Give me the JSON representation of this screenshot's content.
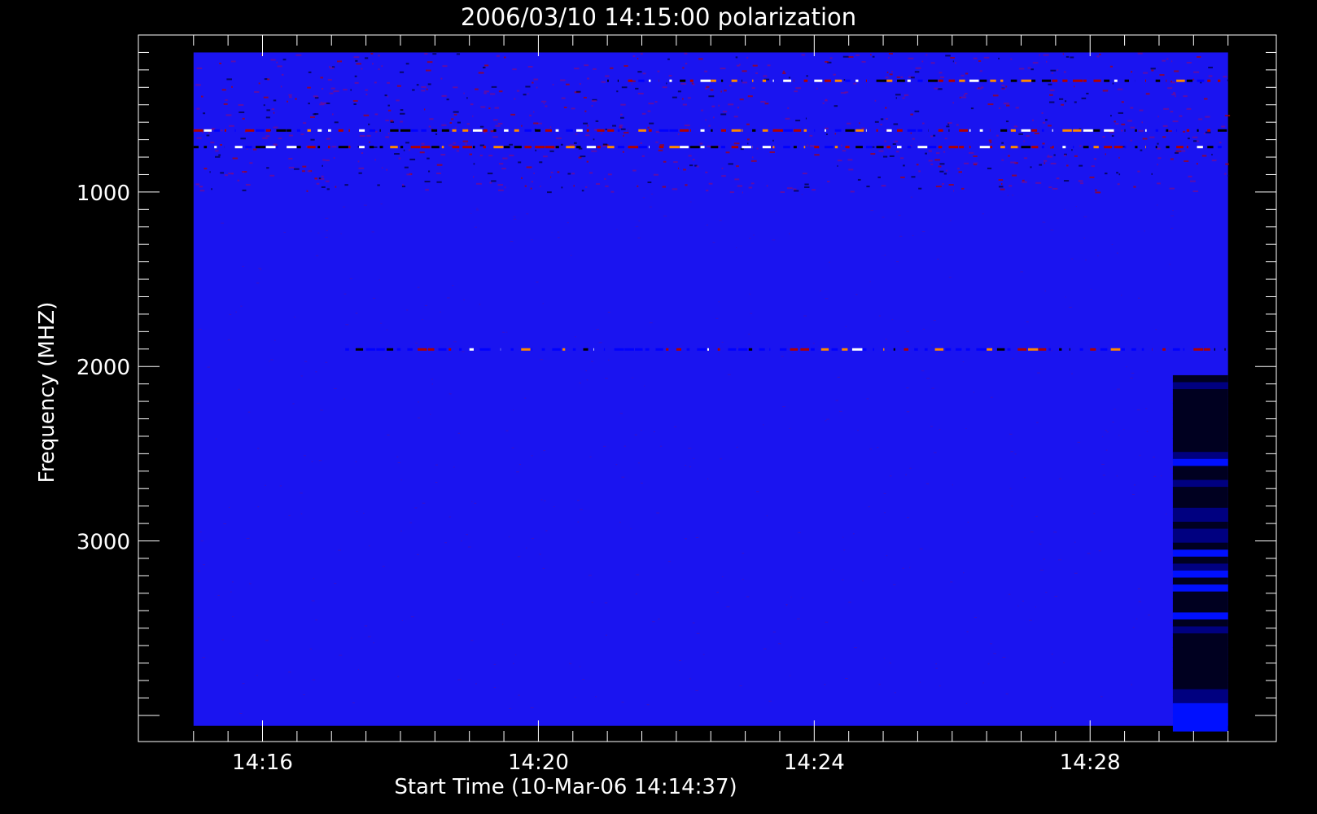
{
  "chart_data": {
    "type": "heatmap",
    "title": "2006/03/10 14:15:00 polarization",
    "xlabel": "Start Time (10-Mar-06 14:14:37)",
    "ylabel": "Frequency (MHZ)",
    "x_ticks": [
      {
        "label": "14:16",
        "minutes": 1.0
      },
      {
        "label": "14:20",
        "minutes": 5.0
      },
      {
        "label": "14:24",
        "minutes": 9.0
      },
      {
        "label": "14:28",
        "minutes": 13.0
      }
    ],
    "x_range_minutes": [
      -0.8,
      15.7
    ],
    "x_data_range_minutes": [
      0.0,
      15.0
    ],
    "y_ticks": [
      {
        "label": "1000",
        "value": 1000
      },
      {
        "label": "2000",
        "value": 2000
      },
      {
        "label": "3000",
        "value": 3000
      }
    ],
    "y_range": [
      100,
      4150
    ],
    "y_data_range": [
      200,
      4060
    ],
    "y_reversed": true,
    "y_minor_step": 100,
    "x_minor_step_minutes": 0.5,
    "colormap": [
      "#000000",
      "#0000ff",
      "#b00000",
      "#ff8800",
      "#ffffff"
    ],
    "background_color": "#1a14f0",
    "features": [
      {
        "type": "band",
        "freq": 360,
        "t0": 6.0,
        "t1": 15.0,
        "intensity": 0.9
      },
      {
        "type": "band",
        "freq": 645,
        "t0": 0.0,
        "t1": 15.0,
        "intensity": 0.85
      },
      {
        "type": "band",
        "freq": 740,
        "t0": 0.0,
        "t1": 15.0,
        "intensity": 0.9
      },
      {
        "type": "band",
        "freq": 1900,
        "t0": 2.2,
        "t1": 15.0,
        "intensity": 0.45
      },
      {
        "type": "dark_block",
        "t0": 14.2,
        "t1": 15.0,
        "f0": 2050,
        "f1": 4060
      }
    ]
  }
}
